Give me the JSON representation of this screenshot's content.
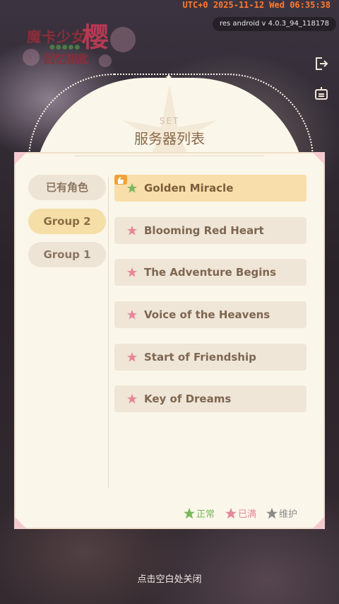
{
  "status_bar": {
    "time": "UTC+0 2025-11-12 Wed 06:35:38"
  },
  "version": "res android v 4.0.3_94_118178",
  "logo": {
    "main": "魔卡少女",
    "big": "樱",
    "sub": "回忆钥匙",
    "dots": "●●●●●"
  },
  "side_icons": [
    "logout-icon",
    "notice-board-icon"
  ],
  "panel": {
    "set_label": "SET",
    "title": "服务器列表",
    "tabs": [
      {
        "label": "已有角色",
        "active": false
      },
      {
        "label": "Group 2",
        "active": true
      },
      {
        "label": "Group 1",
        "active": false
      }
    ],
    "servers": [
      {
        "name": "Golden Miracle",
        "status": "正常",
        "active": true
      },
      {
        "name": "Blooming Red Heart",
        "status": "已满",
        "active": false
      },
      {
        "name": "The Adventure Begins",
        "status": "已满",
        "active": false
      },
      {
        "name": "Voice of the Heavens",
        "status": "已满",
        "active": false
      },
      {
        "name": "Start of Friendship",
        "status": "已满",
        "active": false
      },
      {
        "name": "Key of Dreams",
        "status": "已满",
        "active": false
      }
    ],
    "legend": [
      {
        "label": "正常",
        "color": "#79b85a"
      },
      {
        "label": "已满",
        "color": "#e8869a"
      },
      {
        "label": "维护",
        "color": "#8b8b8b"
      }
    ]
  },
  "close_hint": "点击空白处关闭",
  "colors": {
    "accent": "#f5dfa6",
    "panel_bg": "#fbf6ea",
    "text": "#7e6651"
  }
}
